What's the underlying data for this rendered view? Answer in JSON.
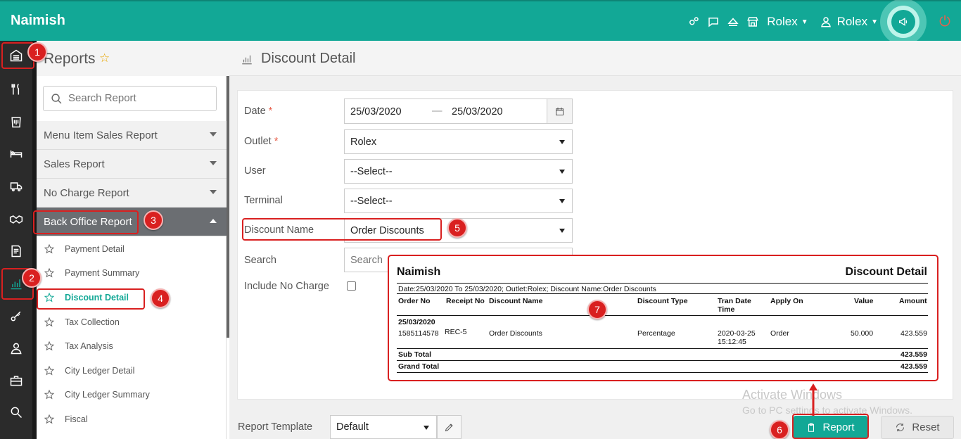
{
  "app": {
    "brand": "Naimish"
  },
  "topbar": {
    "outlet_label": "Rolex",
    "user_label": "Rolex",
    "icons": [
      "gears-icon",
      "chat-icon",
      "eject-icon",
      "store-icon",
      "user-icon",
      "broadcast-icon",
      "power-icon"
    ]
  },
  "rail": {
    "icons": [
      "building-icon",
      "utensils-icon",
      "menu-icon",
      "bed-icon",
      "truck-icon",
      "handshake-icon",
      "report-list-icon",
      "bar-chart-icon",
      "key-icon",
      "person-icon",
      "briefcase-icon",
      "search-icon"
    ],
    "active": "bar-chart-icon"
  },
  "reports_panel": {
    "title": "Reports",
    "search_placeholder": "Search Report",
    "categories": [
      {
        "label": "Menu Item Sales Report"
      },
      {
        "label": "Sales Report"
      },
      {
        "label": "No Charge Report"
      },
      {
        "label": "Back Office Report"
      }
    ],
    "items": [
      {
        "label": "Payment Detail"
      },
      {
        "label": "Payment Summary"
      },
      {
        "label": "Discount Detail"
      },
      {
        "label": "Tax Collection"
      },
      {
        "label": "Tax Analysis"
      },
      {
        "label": "City Ledger Detail"
      },
      {
        "label": "City Ledger Summary"
      },
      {
        "label": "Fiscal"
      }
    ]
  },
  "main": {
    "title": "Discount Detail",
    "form": {
      "date_label": "Date",
      "required_mark": "*",
      "date_from": "25/03/2020",
      "date_sep": "—",
      "date_to": "25/03/2020",
      "outlet_label": "Outlet",
      "outlet_value": "Rolex",
      "user_label": "User",
      "user_value": "--Select--",
      "terminal_label": "Terminal",
      "terminal_value": "--Select--",
      "discount_name_label": "Discount Name",
      "discount_name_value": "Order Discounts",
      "search_label": "Search",
      "search_placeholder": "Search",
      "include_no_charge_label": "Include No Charge"
    },
    "report_template_label": "Report Template",
    "report_template_value": "Default",
    "report_button": "Report",
    "reset_button": "Reset"
  },
  "report_preview": {
    "brand": "Naimish",
    "title": "Discount Detail",
    "filter": "Date:25/03/2020 To 25/03/2020; Outlet:Rolex; Discount Name:Order Discounts",
    "columns": {
      "order_no": "Order No",
      "receipt_no": "Receipt No",
      "discount_name": "Discount Name",
      "discount_type": "Discount Type",
      "tran_date": "Tran Date",
      "tran_time": "Time",
      "apply_on": "Apply On",
      "value": "Value",
      "amount": "Amount"
    },
    "group_date": "25/03/2020",
    "row": {
      "order_no": "1585114578",
      "receipt_no": "REC-5",
      "discount_name": "Order Discounts",
      "discount_type": "Percentage",
      "tran_date": "2020-03-25",
      "tran_time": "15:12:45",
      "apply_on": "Order",
      "value": "50.000",
      "amount": "423.559"
    },
    "sub_total_label": "Sub Total",
    "sub_total": "423.559",
    "grand_total_label": "Grand Total",
    "grand_total": "423.559"
  },
  "annotations": [
    "1",
    "2",
    "3",
    "4",
    "5",
    "6",
    "7"
  ],
  "watermark": {
    "line1": "Activate Windows",
    "line2": "Go to PC settings to activate Windows."
  },
  "colors": {
    "accent": "#12a896",
    "highlight": "#d92020",
    "rail": "#2b2b2b"
  }
}
